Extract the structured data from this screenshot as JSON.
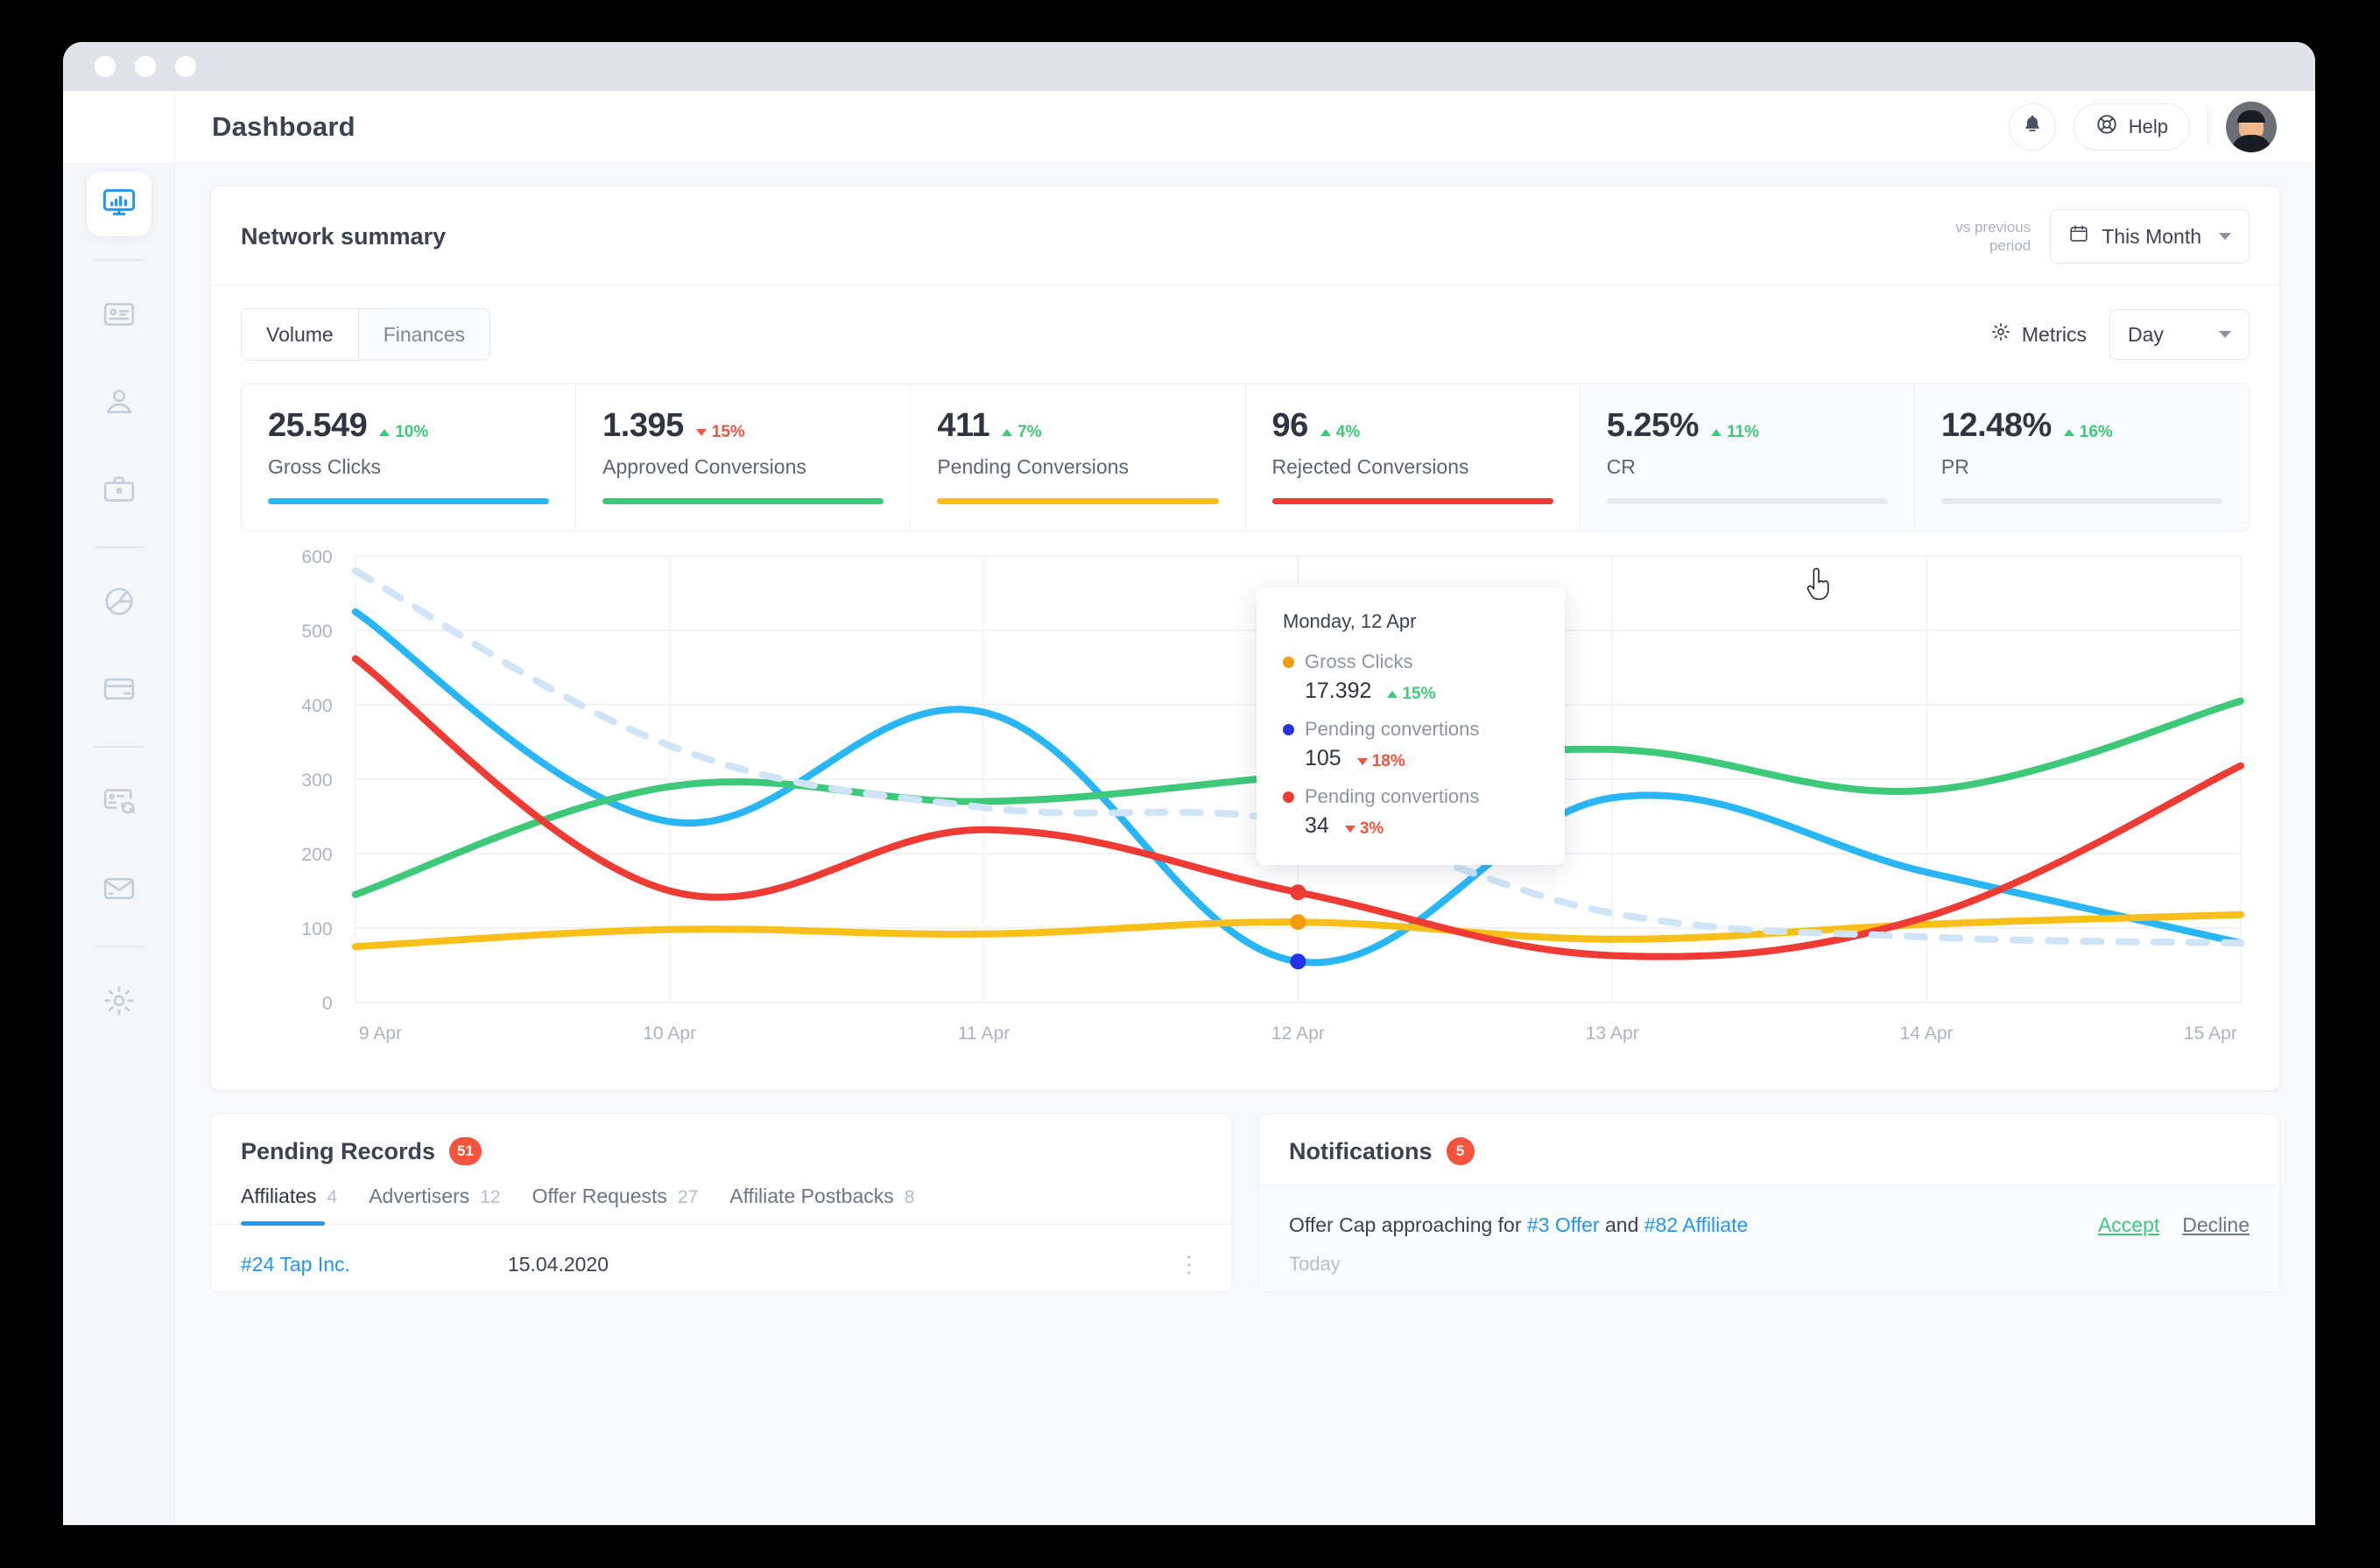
{
  "window": {
    "dots": [
      "close",
      "minimize",
      "maximize"
    ]
  },
  "topbar": {
    "page_title": "Dashboard",
    "help_label": "Help",
    "notifications_icon": "bell-icon",
    "help_icon": "lifebuoy-icon",
    "menu_icon": "hamburger-icon",
    "avatar_alt": "user-avatar"
  },
  "sidebar": {
    "items": [
      {
        "icon": "dashboard-monitor-icon",
        "active": true
      },
      {
        "icon": "id-card-icon",
        "active": false
      },
      {
        "icon": "user-icon",
        "active": false
      },
      {
        "icon": "briefcase-icon",
        "active": false
      },
      {
        "icon": "pie-chart-icon",
        "active": false
      },
      {
        "icon": "credit-card-icon",
        "active": false
      },
      {
        "icon": "postback-sync-icon",
        "active": false
      },
      {
        "icon": "mail-icon",
        "active": false
      },
      {
        "icon": "gear-icon",
        "active": false
      }
    ]
  },
  "network_summary": {
    "title": "Network summary",
    "vs_previous_line1": "vs previous",
    "vs_previous_line2": "period",
    "period_select": {
      "label": "This Month",
      "icon": "calendar-icon"
    },
    "segmented": [
      {
        "label": "Volume",
        "active": true
      },
      {
        "label": "Finances",
        "active": false
      }
    ],
    "metrics_button": {
      "label": "Metrics",
      "icon": "gear-icon"
    },
    "granularity_select": {
      "label": "Day"
    },
    "kpis": [
      {
        "value": "25.549",
        "delta": "10%",
        "direction": "up",
        "label": "Gross Clicks",
        "color": "#29b6f6",
        "muted": false
      },
      {
        "value": "1.395",
        "delta": "15%",
        "direction": "down",
        "label": "Approved Conversions",
        "color": "#3ec97a",
        "muted": false
      },
      {
        "value": "411",
        "delta": "7%",
        "direction": "up",
        "label": "Pending Conversions",
        "color": "#f7bf18",
        "muted": false
      },
      {
        "value": "96",
        "delta": "4%",
        "direction": "up",
        "label": "Rejected Conversions",
        "color": "#ef3b33",
        "muted": false
      },
      {
        "value": "5.25%",
        "delta": "11%",
        "direction": "up",
        "label": "CR",
        "color": "#e6eaef",
        "muted": true
      },
      {
        "value": "12.48%",
        "delta": "16%",
        "direction": "up",
        "label": "PR",
        "color": "#e6eaef",
        "muted": true
      }
    ]
  },
  "chart_data": {
    "type": "line",
    "title": "Network summary",
    "xlabel": "",
    "ylabel": "",
    "x": [
      "9 Apr",
      "10 Apr",
      "11 Apr",
      "12 Apr",
      "13 Apr",
      "14 Apr",
      "15 Apr"
    ],
    "ylim": [
      0,
      600
    ],
    "yticks": [
      0,
      100,
      200,
      300,
      400,
      500,
      600
    ],
    "grid": true,
    "legend": "none",
    "series": [
      {
        "name": "Gross Clicks",
        "color": "#29b6f6",
        "style": "solid",
        "values": [
          525,
          243,
          390,
          55,
          275,
          175,
          80
        ]
      },
      {
        "name": "Approved Conversions",
        "color": "#3ec97a",
        "style": "solid",
        "values": [
          145,
          290,
          270,
          305,
          340,
          285,
          405
        ]
      },
      {
        "name": "Pending Conversions",
        "color": "#f7bf18",
        "style": "solid",
        "values": [
          75,
          98,
          92,
          108,
          85,
          105,
          118
        ]
      },
      {
        "name": "Rejected Conversions",
        "color": "#ef3b33",
        "style": "solid",
        "values": [
          462,
          150,
          232,
          148,
          63,
          115,
          318
        ]
      },
      {
        "name": "Previous period",
        "color": "#cfe4f7",
        "style": "dashed",
        "values": [
          580,
          345,
          262,
          243,
          120,
          88,
          80
        ]
      }
    ]
  },
  "chart_tooltip": {
    "date": "Monday, 12 Apr",
    "rows": [
      {
        "name": "Gross Clicks",
        "dot_color": "#f59a0b",
        "value": "17.392",
        "delta": "15%",
        "direction": "up"
      },
      {
        "name": "Pending convertions",
        "dot_color": "#2433e8",
        "value": "105",
        "delta": "18%",
        "direction": "down"
      },
      {
        "name": "Pending convertions",
        "dot_color": "#ef3b33",
        "value": "34",
        "delta": "3%",
        "direction": "down"
      }
    ]
  },
  "pending_records": {
    "title": "Pending Records",
    "badge": "51",
    "tabs": [
      {
        "label": "Affiliates",
        "count": "4",
        "active": true
      },
      {
        "label": "Advertisers",
        "count": "12",
        "active": false
      },
      {
        "label": "Offer Requests",
        "count": "27",
        "active": false
      },
      {
        "label": "Affiliate Postbacks",
        "count": "8",
        "active": false
      }
    ],
    "rows": [
      {
        "name": "#24 Tap Inc.",
        "date": "15.04.2020",
        "menu": "kebab-menu-icon"
      }
    ]
  },
  "notifications": {
    "title": "Notifications",
    "badge": "5",
    "items": [
      {
        "text_before": "Offer Cap approaching for ",
        "link1": "#3 Offer",
        "text_middle": " and ",
        "link2": "#82 Affiliate",
        "accept_label": "Accept",
        "decline_label": "Decline",
        "time": "Today"
      }
    ]
  },
  "colors": {
    "accent": "#2196f3",
    "positive": "#3ec97a",
    "negative": "#f4533d",
    "badge": "#f4533d"
  }
}
